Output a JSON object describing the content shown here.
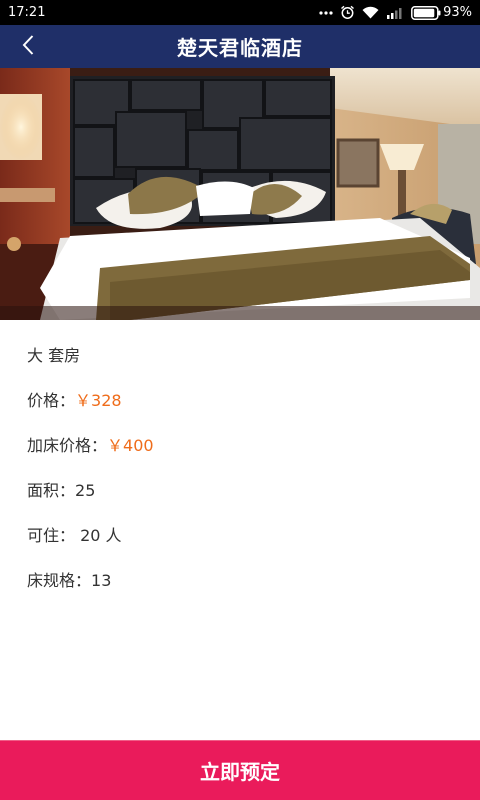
{
  "status_bar": {
    "time": "17:21",
    "notification_icon": "more-dots-icon",
    "alarm_icon": "alarm-icon",
    "wifi_icon": "wifi-icon",
    "signal_icon": "signal-icon",
    "battery_icon": "battery-icon",
    "battery": "93%",
    "battery_level": 0.93
  },
  "header": {
    "title": "楚天君临酒店",
    "back_icon": "chevron-left-icon",
    "background": "#1f2f68"
  },
  "room": {
    "name": "大 套房",
    "price_label": "价格：",
    "price_value": "￥328",
    "extra_bed_label": "加床价格：",
    "extra_bed_value": "￥400",
    "area_label": "面积：",
    "area_value": "25",
    "capacity_label": "可住：",
    "capacity_value": " 20 人",
    "bed_spec_label": "床规格：",
    "bed_spec_value": "13"
  },
  "colors": {
    "price_accent": "#ef6c1a",
    "book_button": "#ea1b5b"
  },
  "actions": {
    "book_label": "立即预定"
  }
}
